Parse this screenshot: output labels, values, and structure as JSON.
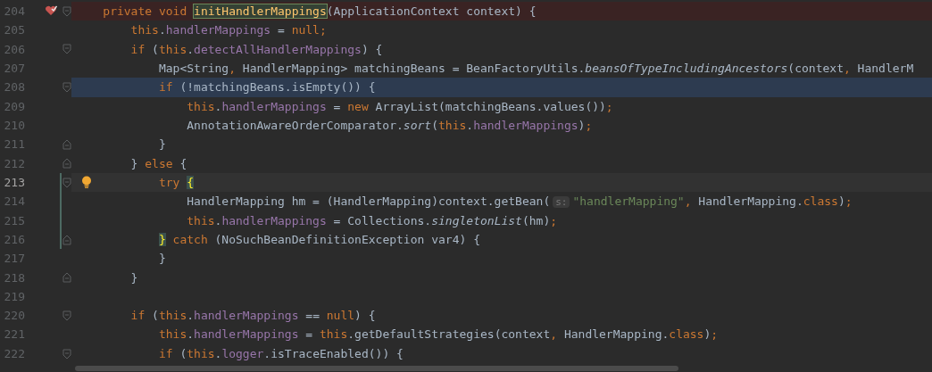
{
  "editor": {
    "lines": [
      {
        "number": "204",
        "breakpoint": true,
        "execution_point": false,
        "caret": false,
        "bulb": false,
        "fold_start": true,
        "fold_end": false,
        "changed": false,
        "tokens": [
          {
            "kind": "keyword",
            "text": "    private void "
          },
          {
            "kind": "declaration",
            "text": "initHandlerMappings"
          },
          {
            "kind": "plain",
            "text": "(ApplicationContext context) {"
          }
        ]
      },
      {
        "number": "205",
        "breakpoint": false,
        "execution_point": false,
        "caret": false,
        "bulb": false,
        "fold_start": false,
        "fold_end": false,
        "changed": false,
        "tokens": [
          {
            "kind": "keyword",
            "text": "        this"
          },
          {
            "kind": "plain",
            "text": "."
          },
          {
            "kind": "field",
            "text": "handlerMappings"
          },
          {
            "kind": "plain",
            "text": " = "
          },
          {
            "kind": "keyword",
            "text": "null;"
          }
        ]
      },
      {
        "number": "206",
        "breakpoint": false,
        "execution_point": false,
        "caret": false,
        "bulb": false,
        "fold_start": true,
        "fold_end": false,
        "changed": false,
        "tokens": [
          {
            "kind": "keyword",
            "text": "        if"
          },
          {
            "kind": "plain",
            "text": " ("
          },
          {
            "kind": "keyword",
            "text": "this"
          },
          {
            "kind": "plain",
            "text": "."
          },
          {
            "kind": "field",
            "text": "detectAllHandlerMappings"
          },
          {
            "kind": "plain",
            "text": ") {"
          }
        ]
      },
      {
        "number": "207",
        "breakpoint": false,
        "execution_point": false,
        "caret": false,
        "bulb": false,
        "fold_start": false,
        "fold_end": false,
        "changed": false,
        "tokens": [
          {
            "kind": "plain",
            "text": "            Map<String"
          },
          {
            "kind": "keyword",
            "text": ","
          },
          {
            "kind": "plain",
            "text": " HandlerMapping> matchingBeans = BeanFactoryUtils."
          },
          {
            "kind": "static",
            "text": "beansOfTypeIncludingAncestors"
          },
          {
            "kind": "plain",
            "text": "(context"
          },
          {
            "kind": "keyword",
            "text": ","
          },
          {
            "kind": "plain",
            "text": " HandlerM"
          }
        ]
      },
      {
        "number": "208",
        "breakpoint": false,
        "execution_point": true,
        "caret": false,
        "bulb": false,
        "fold_start": true,
        "fold_end": false,
        "changed": false,
        "tokens": [
          {
            "kind": "keyword",
            "text": "            if"
          },
          {
            "kind": "plain",
            "text": " (!matchingBeans.isEmpty()) {"
          }
        ]
      },
      {
        "number": "209",
        "breakpoint": false,
        "execution_point": false,
        "caret": false,
        "bulb": false,
        "fold_start": false,
        "fold_end": false,
        "changed": false,
        "tokens": [
          {
            "kind": "keyword",
            "text": "                this"
          },
          {
            "kind": "plain",
            "text": "."
          },
          {
            "kind": "field",
            "text": "handlerMappings"
          },
          {
            "kind": "plain",
            "text": " = "
          },
          {
            "kind": "keyword",
            "text": "new"
          },
          {
            "kind": "plain",
            "text": " ArrayList(matchingBeans.values())"
          },
          {
            "kind": "keyword",
            "text": ";"
          }
        ]
      },
      {
        "number": "210",
        "breakpoint": false,
        "execution_point": false,
        "caret": false,
        "bulb": false,
        "fold_start": false,
        "fold_end": false,
        "changed": false,
        "tokens": [
          {
            "kind": "plain",
            "text": "                AnnotationAwareOrderComparator."
          },
          {
            "kind": "static",
            "text": "sort"
          },
          {
            "kind": "plain",
            "text": "("
          },
          {
            "kind": "keyword",
            "text": "this"
          },
          {
            "kind": "plain",
            "text": "."
          },
          {
            "kind": "field",
            "text": "handlerMappings"
          },
          {
            "kind": "plain",
            "text": ")"
          },
          {
            "kind": "keyword",
            "text": ";"
          }
        ]
      },
      {
        "number": "211",
        "breakpoint": false,
        "execution_point": false,
        "caret": false,
        "bulb": false,
        "fold_start": false,
        "fold_end": true,
        "changed": false,
        "tokens": [
          {
            "kind": "plain",
            "text": "            }"
          }
        ]
      },
      {
        "number": "212",
        "breakpoint": false,
        "execution_point": false,
        "caret": false,
        "bulb": false,
        "fold_start": false,
        "fold_end": true,
        "changed": false,
        "tokens": [
          {
            "kind": "plain",
            "text": "        } "
          },
          {
            "kind": "keyword",
            "text": "else"
          },
          {
            "kind": "plain",
            "text": " {"
          }
        ]
      },
      {
        "number": "213",
        "breakpoint": false,
        "execution_point": false,
        "caret": true,
        "bulb": true,
        "fold_start": true,
        "fold_end": false,
        "changed": true,
        "tokens": [
          {
            "kind": "keyword",
            "text": "            try "
          },
          {
            "kind": "brace",
            "text": "{"
          }
        ]
      },
      {
        "number": "214",
        "breakpoint": false,
        "execution_point": false,
        "caret": false,
        "bulb": false,
        "fold_start": false,
        "fold_end": false,
        "changed": true,
        "tokens": [
          {
            "kind": "plain",
            "text": "                HandlerMapping hm = (HandlerMapping)context.getBean("
          },
          {
            "kind": "hint",
            "text": "s:"
          },
          {
            "kind": "string",
            "text": "\"handlerMapping\""
          },
          {
            "kind": "keyword",
            "text": ","
          },
          {
            "kind": "plain",
            "text": " HandlerMapping."
          },
          {
            "kind": "keyword",
            "text": "class"
          },
          {
            "kind": "plain",
            "text": ")"
          },
          {
            "kind": "keyword",
            "text": ";"
          }
        ]
      },
      {
        "number": "215",
        "breakpoint": false,
        "execution_point": false,
        "caret": false,
        "bulb": false,
        "fold_start": false,
        "fold_end": false,
        "changed": true,
        "tokens": [
          {
            "kind": "keyword",
            "text": "                this"
          },
          {
            "kind": "plain",
            "text": "."
          },
          {
            "kind": "field",
            "text": "handlerMappings"
          },
          {
            "kind": "plain",
            "text": " = Collections."
          },
          {
            "kind": "static",
            "text": "singletonList"
          },
          {
            "kind": "plain",
            "text": "(hm)"
          },
          {
            "kind": "keyword",
            "text": ";"
          }
        ]
      },
      {
        "number": "216",
        "breakpoint": false,
        "execution_point": false,
        "caret": false,
        "bulb": false,
        "fold_start": false,
        "fold_end": true,
        "changed": true,
        "tokens": [
          {
            "kind": "brace",
            "text": "            }"
          },
          {
            "kind": "keyword",
            "text": " catch"
          },
          {
            "kind": "plain",
            "text": " (NoSuchBeanDefinitionException var4) {"
          }
        ]
      },
      {
        "number": "217",
        "breakpoint": false,
        "execution_point": false,
        "caret": false,
        "bulb": false,
        "fold_start": false,
        "fold_end": false,
        "changed": false,
        "tokens": [
          {
            "kind": "plain",
            "text": "            }"
          }
        ]
      },
      {
        "number": "218",
        "breakpoint": false,
        "execution_point": false,
        "caret": false,
        "bulb": false,
        "fold_start": false,
        "fold_end": true,
        "changed": false,
        "tokens": [
          {
            "kind": "plain",
            "text": "        }"
          }
        ]
      },
      {
        "number": "219"
      },
      {
        "number": "220",
        "breakpoint": false,
        "execution_point": false,
        "caret": false,
        "bulb": false,
        "fold_start": true,
        "fold_end": false,
        "changed": false,
        "tokens": [
          {
            "kind": "keyword",
            "text": "        if"
          },
          {
            "kind": "plain",
            "text": " ("
          },
          {
            "kind": "keyword",
            "text": "this"
          },
          {
            "kind": "plain",
            "text": "."
          },
          {
            "kind": "field",
            "text": "handlerMappings"
          },
          {
            "kind": "plain",
            "text": " == "
          },
          {
            "kind": "keyword",
            "text": "null"
          },
          {
            "kind": "plain",
            "text": ") {"
          }
        ]
      },
      {
        "number": "221",
        "breakpoint": false,
        "execution_point": false,
        "caret": false,
        "bulb": false,
        "fold_start": false,
        "fold_end": false,
        "changed": false,
        "tokens": [
          {
            "kind": "keyword",
            "text": "            this"
          },
          {
            "kind": "plain",
            "text": "."
          },
          {
            "kind": "field",
            "text": "handlerMappings"
          },
          {
            "kind": "plain",
            "text": " = "
          },
          {
            "kind": "keyword",
            "text": "this"
          },
          {
            "kind": "plain",
            "text": ".getDefaultStrategies(context"
          },
          {
            "kind": "keyword",
            "text": ","
          },
          {
            "kind": "plain",
            "text": " HandlerMapping."
          },
          {
            "kind": "keyword",
            "text": "class"
          },
          {
            "kind": "plain",
            "text": ")"
          },
          {
            "kind": "keyword",
            "text": ";"
          }
        ]
      },
      {
        "number": "222",
        "breakpoint": false,
        "execution_point": false,
        "caret": false,
        "bulb": false,
        "fold_start": true,
        "fold_end": false,
        "changed": false,
        "tokens": [
          {
            "kind": "keyword",
            "text": "            if"
          },
          {
            "kind": "plain",
            "text": " ("
          },
          {
            "kind": "keyword",
            "text": "this"
          },
          {
            "kind": "plain",
            "text": "."
          },
          {
            "kind": "field",
            "text": "logger"
          },
          {
            "kind": "plain",
            "text": ".isTraceEnabled()) {"
          }
        ]
      }
    ]
  }
}
